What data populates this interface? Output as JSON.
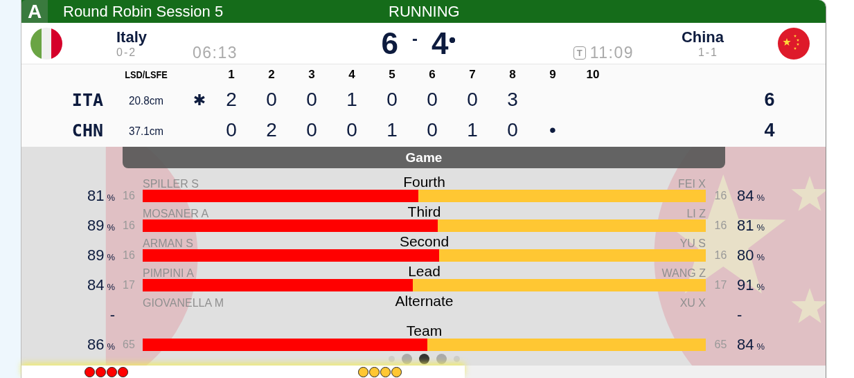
{
  "header": {
    "badge": "A",
    "title": "Round Robin Session 5",
    "status": "RUNNING"
  },
  "teams": [
    {
      "kind": "italy",
      "name": "Italy",
      "record": "0-2",
      "time": "06:13",
      "score": "6",
      "hammer": false
    },
    {
      "kind": "china",
      "name": "China",
      "record": "1-1",
      "timeout_label": "T",
      "time": "11:09",
      "score": "4",
      "hammer": true
    }
  ],
  "score_separator": "-",
  "linescore": {
    "lsd_label": "LSD/LSFE",
    "ends": [
      "1",
      "2",
      "3",
      "4",
      "5",
      "6",
      "7",
      "8",
      "9",
      "10"
    ],
    "rows": [
      {
        "team": "ITA",
        "lsd": "20.8cm",
        "hammer_mark": "✱",
        "ends": [
          "2",
          "0",
          "0",
          "1",
          "0",
          "0",
          "0",
          "3"
        ],
        "total": "6"
      },
      {
        "team": "CHN",
        "lsd": "37.1cm",
        "ends": [
          "0",
          "2",
          "0",
          "0",
          "1",
          "0",
          "1",
          "0",
          "•"
        ],
        "total": "4"
      }
    ]
  },
  "game": {
    "title": "Game",
    "positions": [
      {
        "kind": "bar",
        "position": "Fourth",
        "level": 0.49,
        "left": {
          "player": "SPILLER S",
          "count": "16",
          "pct": "81",
          "unit": "%"
        },
        "right": {
          "player": "FEI X",
          "count": "16",
          "pct": "84",
          "unit": "%"
        }
      },
      {
        "kind": "bar",
        "position": "Third",
        "level": 0.524,
        "left": {
          "player": "MOSANER A",
          "count": "16",
          "pct": "89",
          "unit": "%"
        },
        "right": {
          "player": "LI Z",
          "count": "16",
          "pct": "81",
          "unit": "%"
        }
      },
      {
        "kind": "bar",
        "position": "Second",
        "level": 0.526,
        "left": {
          "player": "ARMAN S",
          "count": "16",
          "pct": "89",
          "unit": "%"
        },
        "right": {
          "player": "YU S",
          "count": "16",
          "pct": "80",
          "unit": "%"
        }
      },
      {
        "kind": "bar",
        "position": "Lead",
        "level": 0.48,
        "left": {
          "player": "PIMPINI A",
          "count": "17",
          "pct": "84",
          "unit": "%"
        },
        "right": {
          "player": "WANG Z",
          "count": "17",
          "pct": "91",
          "unit": "%"
        }
      },
      {
        "kind": "none",
        "position": "Alternate",
        "left": {
          "player": "GIOVANELLA M",
          "pct": "-"
        },
        "right": {
          "player": "XU X",
          "pct": "-"
        }
      },
      {
        "kind": "bar",
        "position": "Team",
        "level": 0.506,
        "left": {
          "count": "65",
          "pct": "86",
          "unit": "%"
        },
        "right": {
          "count": "65",
          "pct": "84",
          "unit": "%"
        }
      }
    ]
  },
  "pager": [
    {
      "selected": false
    },
    {
      "selected": false
    },
    {
      "selected": true
    },
    {
      "selected": false
    },
    {
      "selected": false
    }
  ],
  "stones": {
    "left": [
      {
        "color": "#ff0000"
      },
      {
        "color": "#ff0000"
      },
      {
        "color": "#ff0000"
      },
      {
        "color": "#ff0000"
      }
    ],
    "right": [
      {
        "color": "#ffc733"
      },
      {
        "color": "#ffc733"
      },
      {
        "color": "#ffc733"
      },
      {
        "color": "#ffc733"
      }
    ]
  }
}
